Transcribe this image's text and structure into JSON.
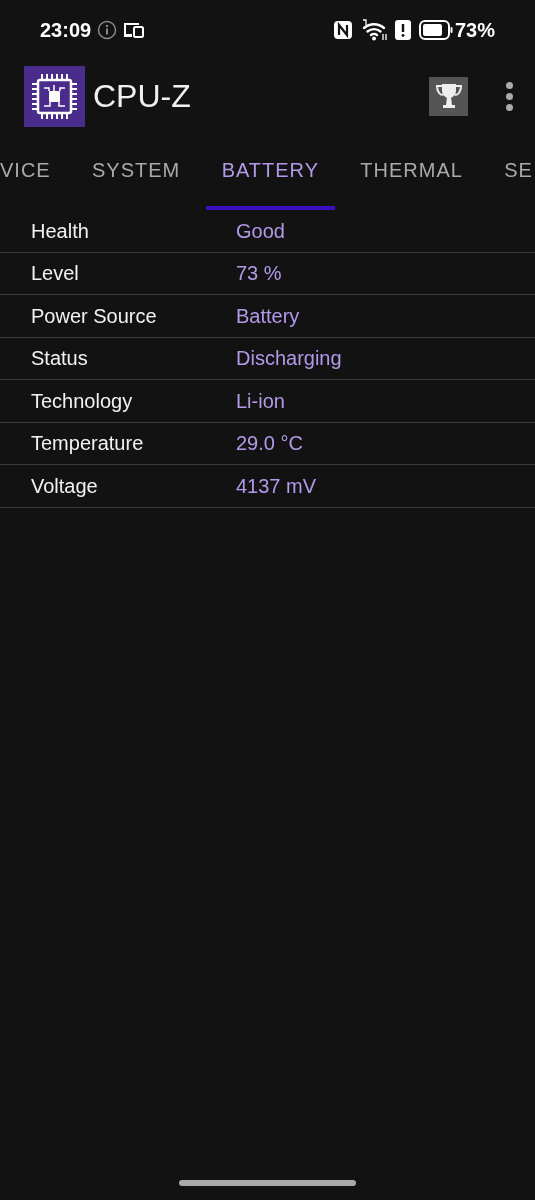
{
  "status_bar": {
    "time": "23:09",
    "battery_percent": "73%"
  },
  "app_bar": {
    "title": "CPU-Z"
  },
  "tabs": [
    {
      "label": "VICE",
      "selected": false
    },
    {
      "label": "SYSTEM",
      "selected": false
    },
    {
      "label": "BATTERY",
      "selected": true
    },
    {
      "label": "THERMAL",
      "selected": false
    },
    {
      "label": "SE",
      "selected": false
    }
  ],
  "rows": [
    {
      "label": "Health",
      "value": "Good"
    },
    {
      "label": "Level",
      "value": "73 %"
    },
    {
      "label": "Power Source",
      "value": "Battery"
    },
    {
      "label": "Status",
      "value": "Discharging"
    },
    {
      "label": "Technology",
      "value": "Li-ion"
    },
    {
      "label": "Temperature",
      "value": "29.0 °C"
    },
    {
      "label": "Voltage",
      "value": "4137 mV"
    }
  ]
}
